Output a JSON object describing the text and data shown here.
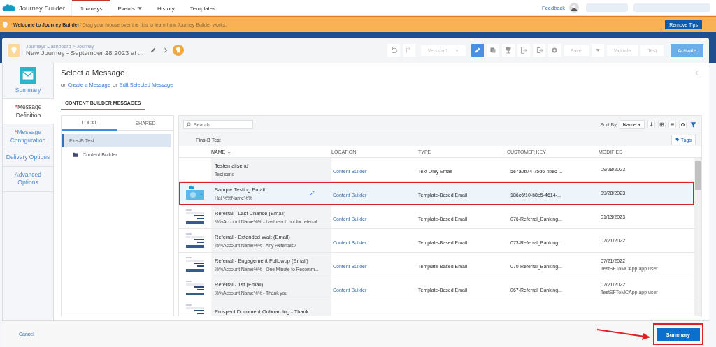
{
  "top_nav": {
    "app_name": "Journey Builder",
    "tabs": [
      {
        "label": "Journeys",
        "selected": true,
        "has_menu": false
      },
      {
        "label": "Events",
        "selected": false,
        "has_menu": true
      },
      {
        "label": "History",
        "selected": false,
        "has_menu": false
      },
      {
        "label": "Templates",
        "selected": false,
        "has_menu": false
      }
    ],
    "feedback": "Feedback"
  },
  "tips_banner": {
    "text": "**Welcome to Journey Builder!** Drag your mouse over the tips to learn how Journey Builder works.",
    "button": "Remove Tips"
  },
  "journey_header": {
    "breadcrumb": "Journeys Dashboard > Journey",
    "title": "New Journey - September 28 2023 at ...",
    "version": "Version 1",
    "save": "Save",
    "validate": "Validate",
    "test": "Test",
    "activate": "Activate"
  },
  "steps": [
    {
      "label": "Summary",
      "selected": false,
      "icon": true
    },
    {
      "required_mark": "*",
      "label": "Message Definition",
      "selected": true,
      "icon": false
    },
    {
      "required_mark": "*",
      "label": "Message Configuration",
      "selected": false,
      "icon": false
    },
    {
      "label": "Delivery Options",
      "selected": false,
      "icon": false
    },
    {
      "label": "Advanced Options",
      "selected": false,
      "icon": false
    }
  ],
  "panel": {
    "title": "Select a Message",
    "links": [
      {
        "kind": "text",
        "text": "or"
      },
      {
        "kind": "link",
        "text": "Create a Message"
      },
      {
        "kind": "text",
        "text": "or"
      },
      {
        "kind": "link",
        "text": "Edit Selected Message"
      }
    ],
    "section_tab": "CONTENT BUILDER MESSAGES",
    "folder_tabs": [
      {
        "label": "LOCAL",
        "selected": true
      },
      {
        "label": "SHARED",
        "selected": false
      }
    ],
    "folders": [
      {
        "label": "Fins-B Test",
        "selected": true,
        "children": [
          {
            "label": "Content Builder",
            "selected": false
          }
        ]
      }
    ],
    "search": {
      "placeholder": "Search"
    },
    "sort_label": "Sort By",
    "sort_value": "Name",
    "path": "Fins-B Test",
    "tags_button": "Tags",
    "columns": [
      {
        "label": "NAME",
        "sorted": true
      },
      {
        "label": "LOCATION",
        "sorted": false
      },
      {
        "label": "TYPE",
        "sorted": false
      },
      {
        "label": "CUSTOMER KEY",
        "sorted": false
      },
      {
        "label": "MODIFIED",
        "sorted": false
      }
    ],
    "rows": [
      {
        "kind": "plain",
        "name": "Testemailsend",
        "subject": "Test send",
        "location": "Content Builder",
        "type": "Text Only Email",
        "key": "5e7a0b74-75d6-4bec-...",
        "modified": "09/28/2023",
        "selected": false,
        "annotated": false
      },
      {
        "kind": "image",
        "name": "Sample Testing Email",
        "subject": "Hai %%Name%%",
        "location": "Content Builder",
        "type": "Template-Based Email",
        "key": "186c6f10-b8e5-4614-...",
        "modified": "09/28/2023",
        "selected": true,
        "annotated": true
      },
      {
        "kind": "template",
        "name": "Referral - Last Chance (Email)",
        "subject": "%%Account Name%% - Last reach out for referral",
        "location": "Content Builder",
        "type": "Template-Based Email",
        "key": "076-Referral_Banking...",
        "modified": "01/13/2023",
        "selected": false,
        "annotated": false
      },
      {
        "kind": "template",
        "name": "Referral - Extended Wait (Email)",
        "subject": "%%Account Name%% - Any Referrals?",
        "location": "Content Builder",
        "type": "Template-Based Email",
        "key": "073-Referral_Banking...",
        "modified": "07/21/2022",
        "selected": false,
        "annotated": false
      },
      {
        "kind": "template",
        "name": "Referral - Engagement Followup (Email)",
        "subject": "%%Account Name%% - One Minute to Recomm...",
        "location": "Content Builder",
        "type": "Template-Based Email",
        "key": "070-Referral_Banking...",
        "modified": "07/21/2022",
        "modified_by": "TestSFToMCApp app user",
        "selected": false,
        "annotated": false
      },
      {
        "kind": "template",
        "name": "Referral - 1st (Email)",
        "subject": "%%Account Name%% - Thank you",
        "location": "Content Builder",
        "type": "Template-Based Email",
        "key": "067-Referral_Banking...",
        "modified": "07/21/2022",
        "modified_by": "TestSFToMCApp app user",
        "selected": false,
        "annotated": false
      },
      {
        "kind": "template",
        "name": "Prospect Document Onboarding - Thank",
        "selected": false,
        "annotated": false
      }
    ]
  },
  "footer": {
    "cancel": "Cancel",
    "next": "Summary",
    "next_annotated": true
  }
}
